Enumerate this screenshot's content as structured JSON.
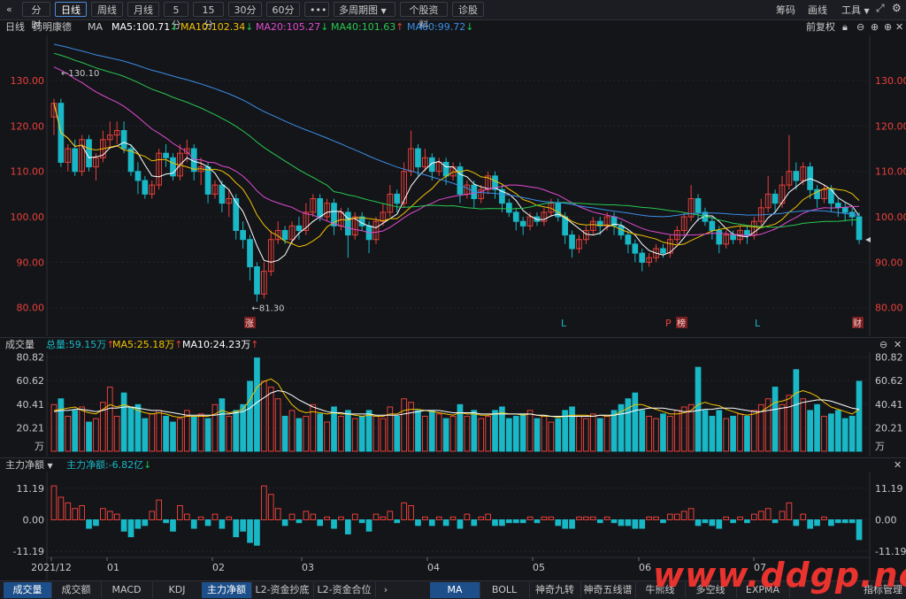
{
  "toolbar": {
    "back_icon": "double-chevron-left-icon",
    "buttons": [
      "分时",
      "日线",
      "周线",
      "月线",
      "5分",
      "15分",
      "30分",
      "60分",
      "•••",
      "多周期图",
      "个股资料",
      "诊股"
    ],
    "right": [
      "筹码",
      "画线",
      "工具"
    ]
  },
  "info": {
    "period": "日线",
    "stock": "药明康德",
    "indicator": "MA",
    "ma5": "MA5:100.71",
    "ma10": "MA10:102.34",
    "ma20": "MA20:105.27",
    "ma40": "MA40:101.63",
    "ma60": "MA60:99.72",
    "adjust": "前复权"
  },
  "volume_header": {
    "title": "成交量",
    "total": "总量:59.15万",
    "ma5": "MA5:25.18万",
    "ma10": "MA10:24.23万"
  },
  "flow_header": {
    "title": "主力净额",
    "value": "主力净额:-6.82亿"
  },
  "markers": {
    "zhang": "涨",
    "l1": "L",
    "p": "P",
    "bang": "榜",
    "l2": "L",
    "cai": "财"
  },
  "price_annotations": {
    "high": "130.10",
    "low": "81.30"
  },
  "x_labels": [
    "2021/12",
    "01",
    "02",
    "03",
    "04",
    "05",
    "06",
    "07"
  ],
  "bottom_tabs_left": [
    "成交量",
    "成交额",
    "MACD",
    "KDJ",
    "主力净额",
    "L2-资金抄底",
    "L2-资金合位"
  ],
  "bottom_tabs_right": [
    "MA",
    "BOLL",
    "神奇九转",
    "神奇五线谱",
    "牛熊线",
    "多空线",
    "EXPMA",
    "指标管理"
  ],
  "watermark": "www.ddgp.net",
  "colors": {
    "up": "#e8403a",
    "down": "#19b8c6",
    "ma5": "#ffffff",
    "ma10": "#f2c200",
    "ma20": "#e04bd0",
    "ma40": "#28c850",
    "ma60": "#3a8ee6",
    "accent": "#1d4f8a"
  },
  "chart_data": {
    "type": "candlestick",
    "price_axis": {
      "ticks": [
        "130.00",
        "120.00",
        "110.00",
        "100.00",
        "90.00",
        "80.00"
      ],
      "ylim": [
        78,
        138
      ]
    },
    "volume_axis": {
      "ticks": [
        "80.82",
        "60.62",
        "40.41",
        "20.21"
      ],
      "unit": "万",
      "ylim": [
        0,
        82
      ]
    },
    "flow_axis": {
      "ticks": [
        "11.19",
        "0.00",
        "-11.19"
      ],
      "ylim": [
        -13,
        13
      ]
    },
    "candles": [
      [
        122,
        125,
        118,
        126,
        12
      ],
      [
        125,
        112,
        111,
        126,
        8
      ],
      [
        112,
        115,
        110,
        116,
        6
      ],
      [
        115,
        110,
        109,
        117,
        4
      ],
      [
        110,
        117,
        109,
        118,
        5
      ],
      [
        117,
        111,
        110,
        118,
        -3
      ],
      [
        111,
        113,
        108,
        114,
        -2
      ],
      [
        113,
        117,
        112,
        119,
        4
      ],
      [
        117,
        118,
        115,
        121,
        3
      ],
      [
        118,
        119,
        116,
        121,
        2
      ],
      [
        119,
        115,
        114,
        121,
        -4
      ],
      [
        115,
        110,
        109,
        116,
        -6
      ],
      [
        110,
        108,
        105,
        112,
        -3
      ],
      [
        108,
        105,
        104,
        109,
        -2
      ],
      [
        105,
        107,
        104,
        108,
        3
      ],
      [
        107,
        114,
        106,
        115,
        7
      ],
      [
        114,
        113,
        111,
        116,
        -1
      ],
      [
        113,
        109,
        108,
        114,
        -4
      ],
      [
        109,
        114,
        108,
        116,
        5
      ],
      [
        114,
        115,
        112,
        117,
        2
      ],
      [
        115,
        110,
        108,
        116,
        -3
      ],
      [
        110,
        111,
        107,
        113,
        1
      ],
      [
        111,
        105,
        103,
        112,
        -2
      ],
      [
        105,
        107,
        104,
        108,
        2
      ],
      [
        107,
        103,
        101,
        108,
        -3
      ],
      [
        103,
        104,
        100,
        106,
        1
      ],
      [
        104,
        97,
        95,
        105,
        -6
      ],
      [
        97,
        95,
        93,
        99,
        -4
      ],
      [
        95,
        89,
        86,
        96,
        -8
      ],
      [
        89,
        83,
        81.3,
        90,
        -9
      ],
      [
        83,
        88,
        82,
        90,
        12
      ],
      [
        88,
        95,
        87,
        97,
        9
      ],
      [
        95,
        97,
        94,
        99,
        4
      ],
      [
        97,
        95,
        94,
        98,
        -2
      ],
      [
        95,
        98,
        94,
        99,
        2
      ],
      [
        98,
        97,
        95,
        100,
        -1
      ],
      [
        97,
        101,
        96,
        103,
        3
      ],
      [
        101,
        104,
        100,
        105,
        2
      ],
      [
        104,
        100,
        99,
        105,
        -2
      ],
      [
        100,
        103,
        99,
        104,
        1
      ],
      [
        103,
        98,
        96,
        104,
        -3
      ],
      [
        98,
        101,
        97,
        102,
        1
      ],
      [
        101,
        96,
        91,
        102,
        -5
      ],
      [
        96,
        100,
        95,
        101,
        2
      ],
      [
        100,
        98,
        97,
        101,
        -1
      ],
      [
        98,
        95,
        92,
        99,
        -4
      ],
      [
        95,
        99,
        94,
        100,
        2
      ],
      [
        99,
        101,
        98,
        103,
        1
      ],
      [
        101,
        105,
        100,
        107,
        3
      ],
      [
        105,
        103,
        101,
        106,
        -1
      ],
      [
        103,
        110,
        102,
        112,
        6
      ],
      [
        110,
        115,
        109,
        119,
        5
      ],
      [
        115,
        111,
        109,
        116,
        -2
      ],
      [
        111,
        113,
        110,
        115,
        1
      ],
      [
        113,
        110,
        108,
        114,
        -2
      ],
      [
        110,
        112,
        109,
        113,
        1
      ],
      [
        112,
        109,
        107,
        113,
        -2
      ],
      [
        109,
        111,
        108,
        112,
        1
      ],
      [
        111,
        105,
        103,
        112,
        -3
      ],
      [
        105,
        107,
        104,
        108,
        2
      ],
      [
        107,
        104,
        102,
        108,
        -2
      ],
      [
        104,
        106,
        103,
        107,
        1
      ],
      [
        106,
        109,
        105,
        110,
        2
      ],
      [
        109,
        106,
        104,
        110,
        -2
      ],
      [
        106,
        103,
        101,
        107,
        -2
      ],
      [
        103,
        101,
        100,
        104,
        -1
      ],
      [
        101,
        99,
        97,
        102,
        -1
      ],
      [
        99,
        98,
        96,
        100,
        -1
      ],
      [
        98,
        100,
        97,
        101,
        1
      ],
      [
        100,
        99,
        98,
        101,
        -1
      ],
      [
        99,
        101,
        98,
        102,
        1
      ],
      [
        101,
        103,
        100,
        104,
        1
      ],
      [
        103,
        100,
        99,
        104,
        -2
      ],
      [
        100,
        96,
        94,
        101,
        -3
      ],
      [
        96,
        93,
        91,
        97,
        -3
      ],
      [
        93,
        95,
        92,
        96,
        1
      ],
      [
        95,
        97,
        94,
        98,
        1
      ],
      [
        97,
        99,
        96,
        100,
        1
      ],
      [
        99,
        98,
        96,
        100,
        -1
      ],
      [
        98,
        100,
        97,
        101,
        1
      ],
      [
        100,
        98,
        96,
        101,
        -1
      ],
      [
        98,
        96,
        95,
        99,
        -2
      ],
      [
        96,
        94,
        92,
        97,
        -2
      ],
      [
        94,
        92,
        90,
        95,
        -3
      ],
      [
        92,
        90,
        88,
        93,
        -3
      ],
      [
        90,
        91,
        89,
        92,
        1
      ],
      [
        91,
        93,
        90,
        94,
        1
      ],
      [
        93,
        92,
        91,
        94,
        -1
      ],
      [
        92,
        95,
        91,
        96,
        2
      ],
      [
        95,
        97,
        94,
        98,
        2
      ],
      [
        97,
        100,
        96,
        101,
        3
      ],
      [
        100,
        104,
        99,
        107,
        4
      ],
      [
        104,
        101,
        99,
        105,
        -2
      ],
      [
        101,
        99,
        98,
        102,
        -1
      ],
      [
        99,
        97,
        95,
        100,
        -2
      ],
      [
        97,
        94,
        92,
        98,
        -3
      ],
      [
        94,
        96,
        93,
        97,
        1
      ],
      [
        96,
        95,
        94,
        97,
        -1
      ],
      [
        95,
        97,
        94,
        98,
        1
      ],
      [
        97,
        96,
        94,
        98,
        -1
      ],
      [
        96,
        99,
        95,
        100,
        2
      ],
      [
        99,
        102,
        98,
        104,
        3
      ],
      [
        102,
        105,
        101,
        109,
        4
      ],
      [
        105,
        103,
        101,
        106,
        -1
      ],
      [
        103,
        107,
        102,
        109,
        3
      ],
      [
        107,
        110,
        106,
        118,
        6
      ],
      [
        110,
        108,
        106,
        112,
        -2
      ],
      [
        108,
        111,
        107,
        112,
        2
      ],
      [
        111,
        106,
        104,
        112,
        -3
      ],
      [
        106,
        104,
        102,
        107,
        -2
      ],
      [
        104,
        106,
        103,
        107,
        1
      ],
      [
        106,
        103,
        101,
        107,
        -2
      ],
      [
        103,
        102,
        100,
        104,
        -1
      ],
      [
        102,
        101,
        99,
        103,
        -1
      ],
      [
        101,
        100,
        98,
        102,
        -1
      ],
      [
        100,
        95,
        94,
        101,
        -7
      ]
    ],
    "volume": [
      40,
      45,
      30,
      35,
      38,
      25,
      28,
      42,
      55,
      30,
      50,
      38,
      40,
      28,
      32,
      35,
      30,
      25,
      28,
      35,
      30,
      32,
      28,
      40,
      45,
      30,
      35,
      40,
      60,
      80,
      60,
      55,
      45,
      30,
      35,
      28,
      30,
      40,
      32,
      25,
      38,
      30,
      35,
      28,
      30,
      35,
      30,
      28,
      38,
      30,
      45,
      42,
      35,
      30,
      35,
      32,
      28,
      30,
      40,
      30,
      35,
      28,
      30,
      35,
      38,
      28,
      30,
      32,
      35,
      28,
      30,
      25,
      28,
      35,
      38,
      30,
      28,
      32,
      28,
      30,
      35,
      40,
      45,
      50,
      35,
      30,
      28,
      32,
      30,
      35,
      38,
      40,
      72,
      35,
      30,
      35,
      28,
      30,
      32,
      30,
      35,
      40,
      45,
      55,
      40,
      48,
      70,
      45,
      35,
      40,
      30,
      32,
      35,
      28,
      30,
      60
    ],
    "ma5_vol": [
      35,
      36,
      37,
      38,
      35,
      33,
      32,
      36,
      40,
      38,
      40,
      38,
      35,
      33,
      32,
      33,
      32,
      30,
      29,
      30,
      30,
      30,
      30,
      32,
      35,
      33,
      34,
      36,
      44,
      55,
      60,
      62,
      58,
      48,
      40,
      35,
      33,
      34,
      33,
      32,
      33,
      32,
      32,
      31,
      30,
      31,
      30,
      30,
      32,
      32,
      35,
      36,
      36,
      35,
      34,
      33,
      32,
      31,
      33,
      32,
      32,
      31,
      31,
      32,
      33,
      32,
      32,
      31,
      32,
      31,
      30,
      30,
      29,
      30,
      31,
      31,
      31,
      30,
      31,
      30,
      31,
      34,
      37,
      40,
      40,
      38,
      36,
      34,
      32,
      32,
      33,
      35,
      40,
      42,
      40,
      39,
      36,
      34,
      32,
      31,
      32,
      34,
      38,
      42,
      43,
      45,
      50,
      52,
      50,
      47,
      42,
      38,
      36,
      34,
      32,
      36
    ],
    "ma10_vol": [
      34,
      35,
      35,
      36,
      36,
      35,
      34,
      35,
      37,
      37,
      38,
      38,
      37,
      36,
      35,
      35,
      34,
      33,
      32,
      31,
      31,
      31,
      31,
      31,
      32,
      32,
      33,
      34,
      37,
      42,
      46,
      50,
      52,
      51,
      48,
      44,
      41,
      38,
      36,
      34,
      33,
      33,
      32,
      32,
      32,
      32,
      31,
      31,
      31,
      31,
      32,
      33,
      34,
      35,
      35,
      35,
      34,
      33,
      33,
      33,
      33,
      32,
      32,
      32,
      32,
      32,
      32,
      32,
      32,
      31,
      31,
      30,
      30,
      30,
      30,
      30,
      30,
      30,
      31,
      31,
      31,
      32,
      33,
      35,
      36,
      37,
      37,
      37,
      36,
      35,
      34,
      34,
      35,
      36,
      36,
      37,
      37,
      37,
      36,
      35,
      34,
      34,
      35,
      36,
      37,
      38,
      40,
      42,
      43,
      44,
      44,
      43,
      41,
      39,
      37,
      36
    ]
  }
}
